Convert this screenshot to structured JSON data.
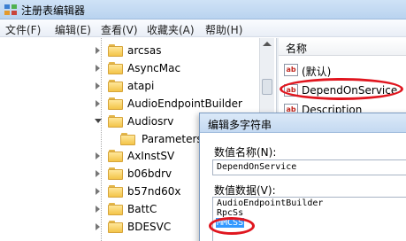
{
  "window": {
    "title": "注册表编辑器"
  },
  "menu": [
    "文件(F)",
    "编辑(E)",
    "查看(V)",
    "收藏夹(A)",
    "帮助(H)"
  ],
  "tree": {
    "items": [
      {
        "label": "arcsas"
      },
      {
        "label": "AsyncMac"
      },
      {
        "label": "atapi"
      },
      {
        "label": "AudioEndpointBuilder"
      },
      {
        "label": "Audiosrv",
        "selected": true,
        "expanded": true
      },
      {
        "label": "Parameters",
        "child": true
      },
      {
        "label": "AxInstSV"
      },
      {
        "label": "b06bdrv"
      },
      {
        "label": "b57nd60x"
      },
      {
        "label": "BattC"
      },
      {
        "label": "BDESVC"
      }
    ]
  },
  "values_pane": {
    "header": "名称",
    "rows": [
      {
        "label": "(默认)"
      },
      {
        "label": "DependOnService"
      },
      {
        "label": "Description"
      }
    ],
    "icon_text": "ab"
  },
  "dialog": {
    "title": "编辑多字符串",
    "name_label": "数值名称(N):",
    "name_value": "DependOnService",
    "data_label": "数值数据(V):",
    "data_lines": [
      "AudioEndpointBuilder",
      "RpcSs",
      "MMCSS"
    ]
  },
  "colors": {
    "annotation": "#e0161f",
    "selection": "#3399ff",
    "folder": "#f3c449"
  }
}
